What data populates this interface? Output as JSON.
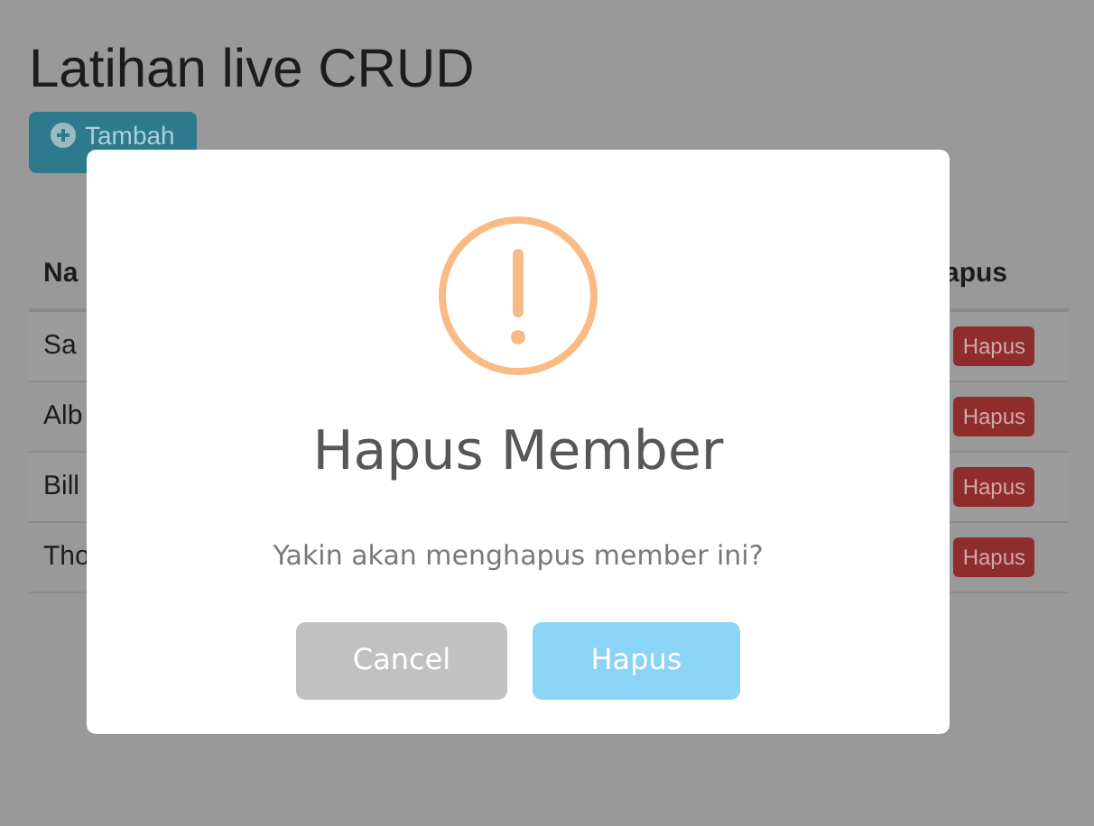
{
  "page": {
    "title": "Latihan live CRUD",
    "add_button": "Tambah",
    "table": {
      "columns": [
        "Na",
        "apus"
      ],
      "rows": [
        {
          "name": "Sa",
          "action": "Hapus"
        },
        {
          "name": "Alb",
          "action": "Hapus"
        },
        {
          "name": "Bill",
          "action": "Hapus"
        },
        {
          "name": "Tho",
          "action": "Hapus"
        }
      ]
    }
  },
  "dialog": {
    "title": "Hapus Member",
    "message": "Yakin akan menghapus member ini?",
    "buttons": [
      {
        "label": "Cancel",
        "kind": "cancel"
      },
      {
        "label": "Hapus",
        "kind": "confirm"
      }
    ]
  }
}
